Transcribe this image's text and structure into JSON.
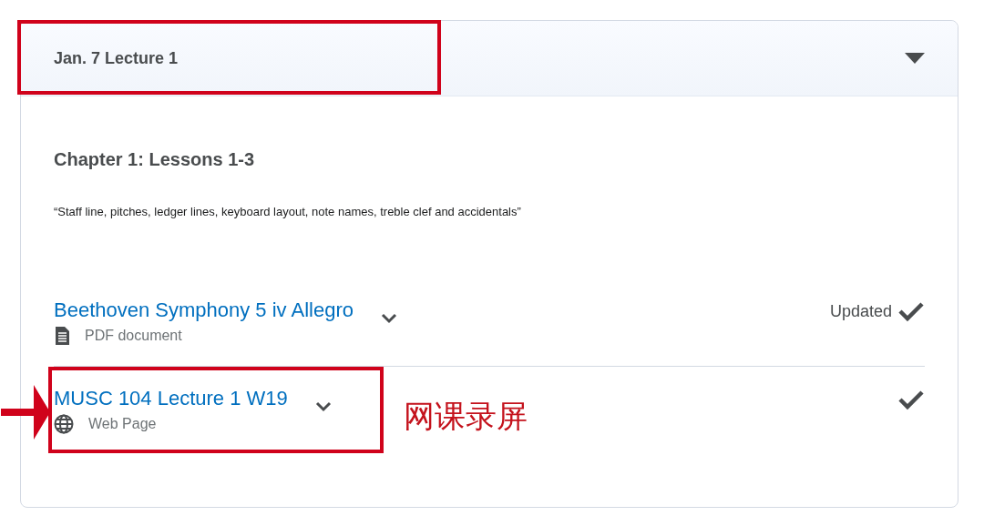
{
  "module": {
    "title": "Jan. 7 Lecture 1",
    "expanded": true,
    "highlighted": true
  },
  "section": {
    "heading": "Chapter 1: Lessons 1-3",
    "description": "“Staff line, pitches, ledger lines, keyboard layout, note names, treble clef and accidentals”"
  },
  "items": [
    {
      "title": "Beethoven Symphony 5 iv Allegro",
      "type_label": "PDF document",
      "kind": "pdf",
      "status": "Updated",
      "completed": true,
      "highlighted": false
    },
    {
      "title": "MUSC 104 Lecture 1 W19",
      "type_label": "Web Page",
      "kind": "web",
      "completed": true,
      "highlighted": true
    }
  ],
  "annotation": {
    "note": "网课录屏"
  }
}
